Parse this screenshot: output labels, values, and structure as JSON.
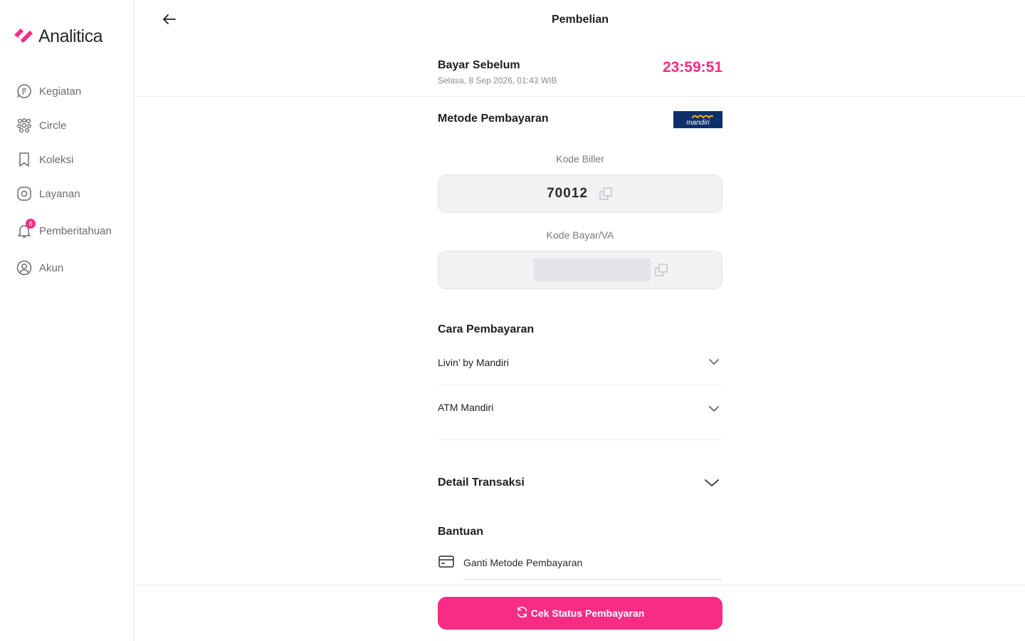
{
  "brand": {
    "name": "Analitica",
    "accent": "#f72c84"
  },
  "sidebar": {
    "items": [
      {
        "label": "Kegiatan",
        "icon": "activity-chat-icon"
      },
      {
        "label": "Circle",
        "icon": "circle-group-icon"
      },
      {
        "label": "Koleksi",
        "icon": "bookmark-icon"
      },
      {
        "label": "Layanan",
        "icon": "compass-icon"
      },
      {
        "label": "Pemberitahuan",
        "icon": "bell-icon",
        "badge": "8"
      },
      {
        "label": "Akun",
        "icon": "user-circle-icon"
      }
    ]
  },
  "header": {
    "title": "Pembelian"
  },
  "payment": {
    "pay_before_label": "Bayar Sebelum",
    "pay_before_date": "Selasa, 8 Sep 2026, 01:43 WIB",
    "countdown": "23:59:51",
    "method_label": "Metode Pembayaran",
    "bank_name": "mandiri",
    "biller_label": "Kode Biller",
    "biller_code": "70012",
    "va_label": "Kode Bayar/VA"
  },
  "how_to_pay": {
    "title": "Cara Pembayaran",
    "options": [
      "Livin’ by Mandiri",
      "ATM Mandiri"
    ]
  },
  "transaction_detail": {
    "title": "Detail Transaksi"
  },
  "help": {
    "title": "Bantuan",
    "change_method": "Ganti Metode Pembayaran"
  },
  "cta": {
    "label": "Cek Status Pembayaran"
  }
}
